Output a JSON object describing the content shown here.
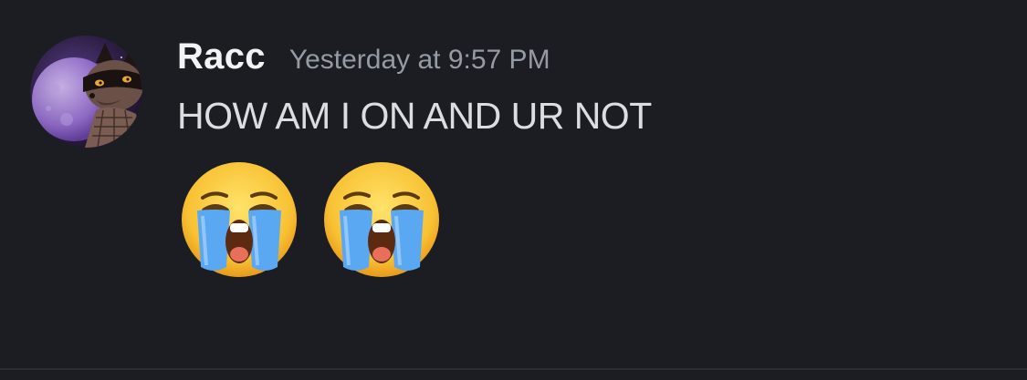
{
  "message": {
    "author": "Racc",
    "timestamp": "Yesterday at 9:57 PM",
    "content": "HOW AM I ON AND UR NOT",
    "emojis": [
      {
        "name": "loudly-crying-face",
        "glyph": "😭"
      },
      {
        "name": "loudly-crying-face",
        "glyph": "😭"
      }
    ]
  },
  "colors": {
    "background": "#1c1d22",
    "username": "#f2f3f5",
    "timestamp": "#949ba4",
    "text": "#dbdee1",
    "avatar_ring": "#8a5cc7"
  }
}
